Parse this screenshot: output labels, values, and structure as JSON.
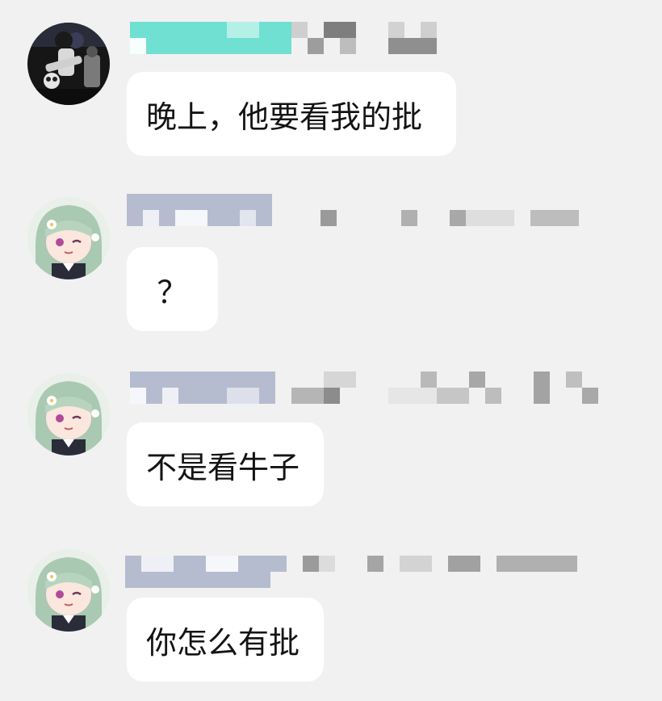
{
  "messages": [
    {
      "sender_avatar": "guitarist-photo-avatar",
      "text": "晚上，他要看我的批"
    },
    {
      "sender_avatar": "anime-girl-avatar",
      "text": "？"
    },
    {
      "sender_avatar": "anime-girl-avatar",
      "text": "不是看牛子"
    },
    {
      "sender_avatar": "anime-girl-avatar",
      "text": "你怎么有批"
    }
  ],
  "colors": {
    "background": "#f1f1f1",
    "bubble": "#ffffff",
    "text": "#141414",
    "name_teal": "#6fe0d2",
    "name_lavender": "#b6bccf"
  }
}
